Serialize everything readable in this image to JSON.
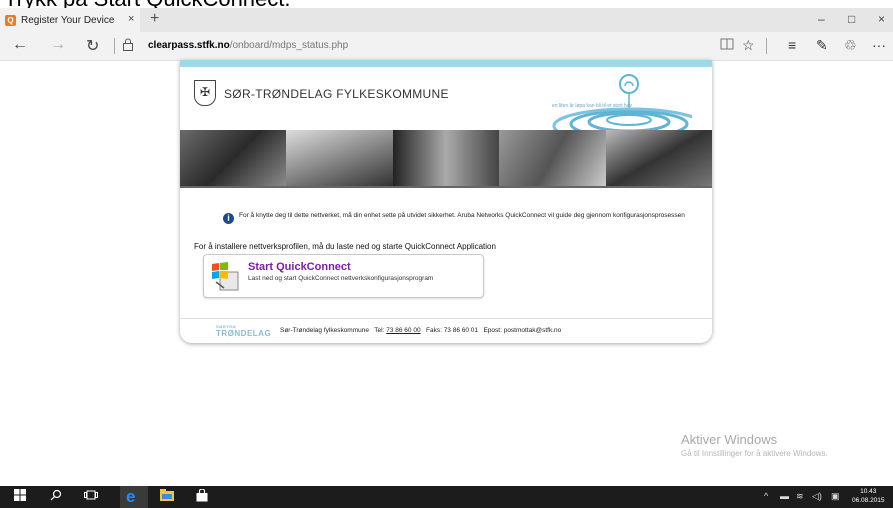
{
  "caption": "Trykk på Start QuickConnect.",
  "browser": {
    "tab_title": "Register Your Device",
    "tab_close": "×",
    "new_tab": "+",
    "window_buttons": [
      "–",
      "□",
      "×"
    ],
    "nav": {
      "back": "←",
      "forward": "→",
      "refresh": "↻"
    },
    "url_host": "clearpass.stfk.no",
    "url_path": "/onboard/mdps_status.php",
    "tools": [
      "☆",
      "≡",
      "✎",
      "♲",
      "···"
    ]
  },
  "page": {
    "org_name": "SØR-TRØNDELAG FYLKESKOMMUNE",
    "slogan": "en liten år løpa kan bli til et stort hav",
    "info_text": "For å knytte deg til dette nettverket, må din enhet sette på utvidet sikkerhet. Aruba Networks QuickConnect vil guide deg gjennom konfigurasjonsprosessen",
    "install_text": "For å installere nettverksprofilen, må du laste ned og starte QuickConnect Application",
    "quickconnect": {
      "title": "Start QuickConnect",
      "subtitle": "Last ned og start QuickConnect nettverkskonfigurasjonsprogram"
    },
    "footer": {
      "logo_top": "SØRTRØ",
      "logo": "TRØNDELAG",
      "name": "Sør-Trøndelag fylkeskommune",
      "tel_label": "Tel:",
      "tel": "73 86 60 00",
      "fax": "Faks: 73 86 60 01",
      "email": "Epost: postmottak@stfk.no"
    }
  },
  "watermark": {
    "title": "Aktiver Windows",
    "subtitle": "Gå til Innstillinger for å aktivere Windows."
  },
  "taskbar": {
    "time": "10.43",
    "date": "06.08.2015"
  }
}
